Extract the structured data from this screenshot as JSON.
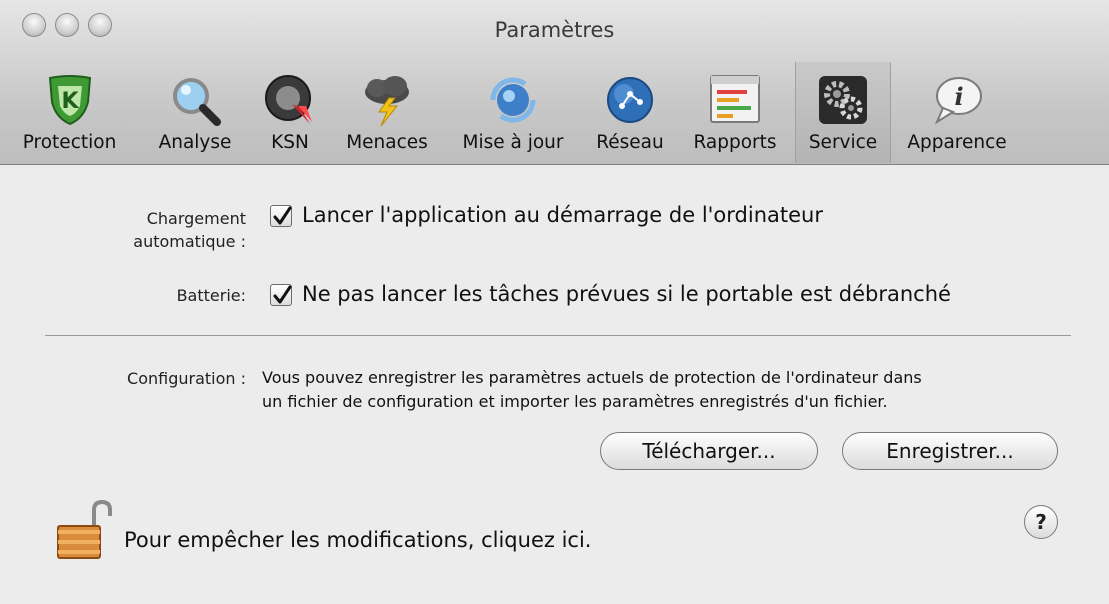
{
  "window": {
    "title": "Paramètres"
  },
  "toolbar": {
    "items": [
      {
        "label": "Protection",
        "icon": "shield-k-icon"
      },
      {
        "label": "Analyse",
        "icon": "magnifier-icon"
      },
      {
        "label": "KSN",
        "icon": "ksn-network-icon"
      },
      {
        "label": "Menaces",
        "icon": "storm-cloud-icon"
      },
      {
        "label": "Mise à jour",
        "icon": "update-globe-icon"
      },
      {
        "label": "Réseau",
        "icon": "network-globe-icon"
      },
      {
        "label": "Rapports",
        "icon": "report-chart-icon"
      },
      {
        "label": "Service",
        "icon": "gears-icon"
      },
      {
        "label": "Apparence",
        "icon": "info-bubble-icon"
      }
    ],
    "selected": "Service"
  },
  "autoload": {
    "label_line1": "Chargement",
    "label_line2": "automatique :",
    "checkbox_text": "Lancer l'application au démarrage de l'ordinateur",
    "checked": true
  },
  "battery": {
    "label": "Batterie:",
    "checkbox_text": "Ne pas lancer les tâches prévues si le portable est débranché",
    "checked": true
  },
  "configuration": {
    "label": "Configuration :",
    "description_line1": "Vous pouvez enregistrer les paramètres actuels de protection de l'ordinateur dans",
    "description_line2": "un fichier de configuration et importer les paramètres enregistrés d'un fichier.",
    "download_button": "Télécharger...",
    "save_button": "Enregistrer..."
  },
  "footer": {
    "lock_text": "Pour empêcher les modifications, cliquez ici.",
    "help_label": "?"
  }
}
